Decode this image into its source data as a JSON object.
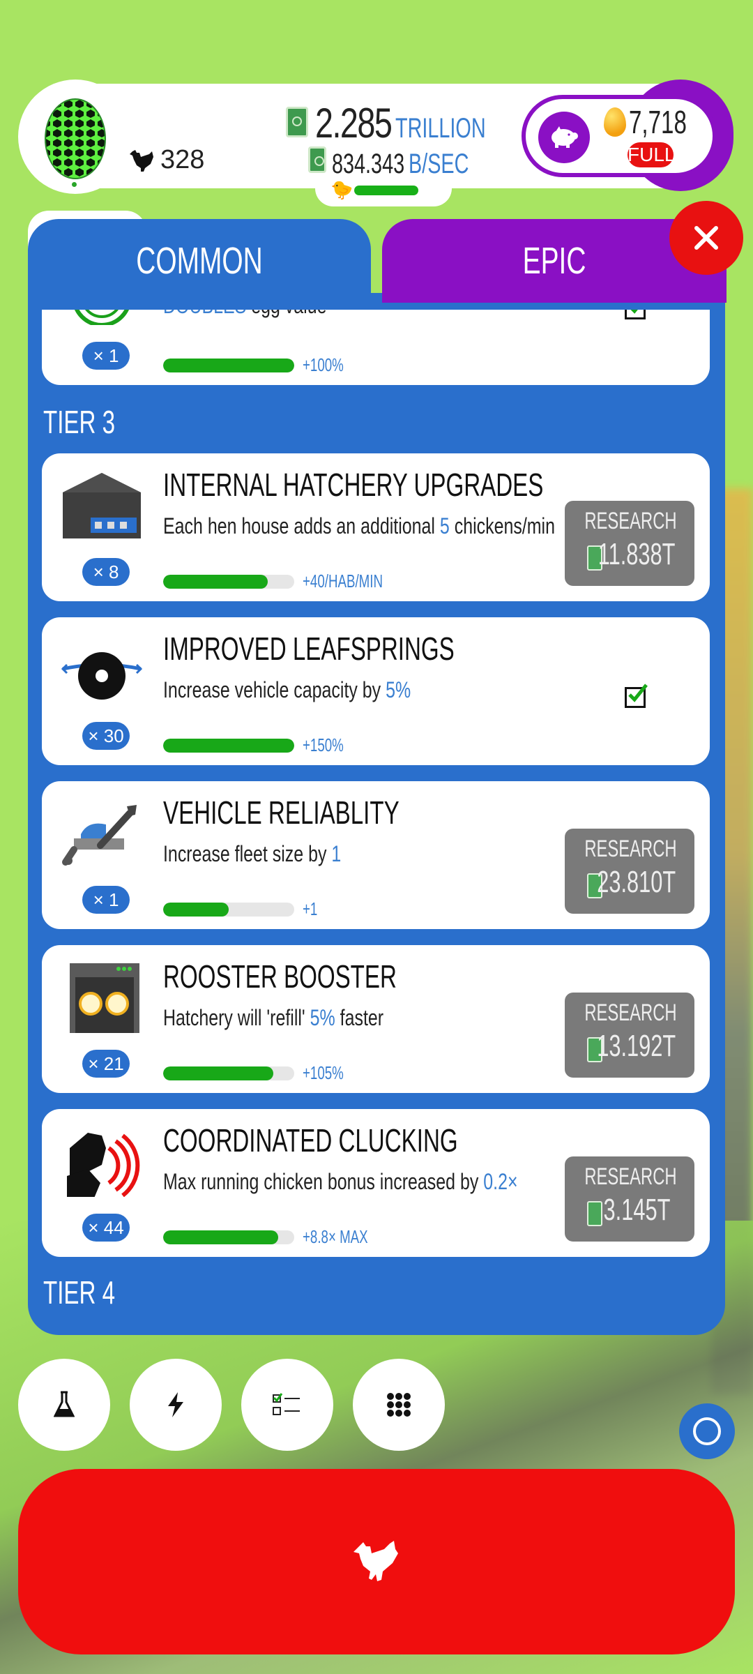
{
  "header": {
    "chicken_count": "328",
    "money_amount": "2.285",
    "money_unit": "TRILLION",
    "rate_amount": "834.343",
    "rate_unit": "B/SEC",
    "golden_eggs": "7,718",
    "piggy_status": "FULL"
  },
  "tabs": [
    {
      "label": "COMMON"
    },
    {
      "label": "EPIC"
    }
  ],
  "partial_card": {
    "desc_hl": "DOUBLES",
    "desc_rest": "egg value",
    "count": "× 1",
    "bar_text": "+100%",
    "progress": 1.0
  },
  "tiers": {
    "tier3": "TIER 3",
    "tier4": "TIER 4"
  },
  "cards": [
    {
      "title": "INTERNAL HATCHERY UPGRADES",
      "desc_pre": "Each hen house adds an additional",
      "desc_hl": "5",
      "desc_post": "chickens/min",
      "count": "× 8",
      "bar_text": "+40/HAB/MIN",
      "progress": 0.8,
      "research_label": "RESEARCH",
      "cost": "11.838T",
      "icon": "hen-house-icon"
    },
    {
      "title": "IMPROVED LEAFSPRINGS",
      "desc_pre": "Increase vehicle capacity by",
      "desc_hl": "5%",
      "desc_post": "",
      "count": "× 30",
      "bar_text": "+150%",
      "progress": 1.0,
      "icon": "wheel-icon"
    },
    {
      "title": "VEHICLE RELIABLITY",
      "desc_pre": "Increase fleet size by",
      "desc_hl": "1",
      "desc_post": "",
      "count": "× 1",
      "bar_text": "+1",
      "progress": 0.5,
      "research_label": "RESEARCH",
      "cost": "23.810T",
      "icon": "wrench-cart-icon"
    },
    {
      "title": "ROOSTER BOOSTER",
      "desc_pre": "Hatchery will 'refill'",
      "desc_hl": "5%",
      "desc_post": "faster",
      "count": "× 21",
      "bar_text": "+105%",
      "progress": 0.84,
      "research_label": "RESEARCH",
      "cost": "13.192T",
      "icon": "incubator-icon"
    },
    {
      "title": "COORDINATED CLUCKING",
      "desc_pre": "Max running chicken bonus increased by",
      "desc_hl": "0.2×",
      "desc_post": "",
      "count": "× 44",
      "bar_text": "+8.8× MAX",
      "progress": 0.88,
      "research_label": "RESEARCH",
      "cost": "3.145T",
      "icon": "clucking-chickens-icon"
    }
  ],
  "colors": {
    "accent_blue": "#2a6fcc",
    "epic_purple": "#8a10c4",
    "red": "#e81111",
    "progress_green": "#18a818",
    "background_green": "#a8e462"
  }
}
